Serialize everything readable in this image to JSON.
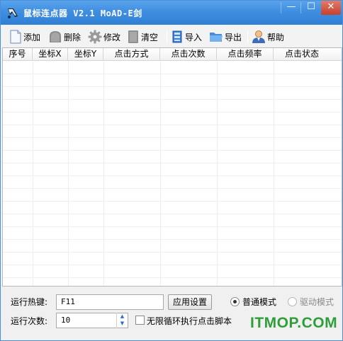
{
  "window": {
    "title": "鼠标连点器 V2.1 MoAD-E剑",
    "controls": {
      "minimize": "—",
      "maximize": "☐",
      "close": "✕"
    }
  },
  "toolbar": {
    "add": "添加",
    "delete": "删除",
    "edit": "修改",
    "clear": "清空",
    "import": "导入",
    "export": "导出",
    "help": "帮助"
  },
  "table": {
    "columns": [
      "序号",
      "坐标X",
      "坐标Y",
      "点击方式",
      "点击次数",
      "点击频率",
      "点击状态"
    ],
    "rows": []
  },
  "settings": {
    "hotkey_label": "运行热键:",
    "hotkey_value": "F11",
    "apply_button": "应用设置",
    "mode_normal": "普通模式",
    "mode_driver": "驱动模式",
    "count_label": "运行次数:",
    "count_value": "10",
    "infinite_loop": "无限循环执行点击脚本",
    "selected_mode": "normal",
    "infinite_checked": false
  },
  "watermark": "ITMOP.COM",
  "colors": {
    "titlebar": "#3f8ee0",
    "watermark": "#2e9e3a",
    "spin_arrow": "#2a6fc6"
  }
}
